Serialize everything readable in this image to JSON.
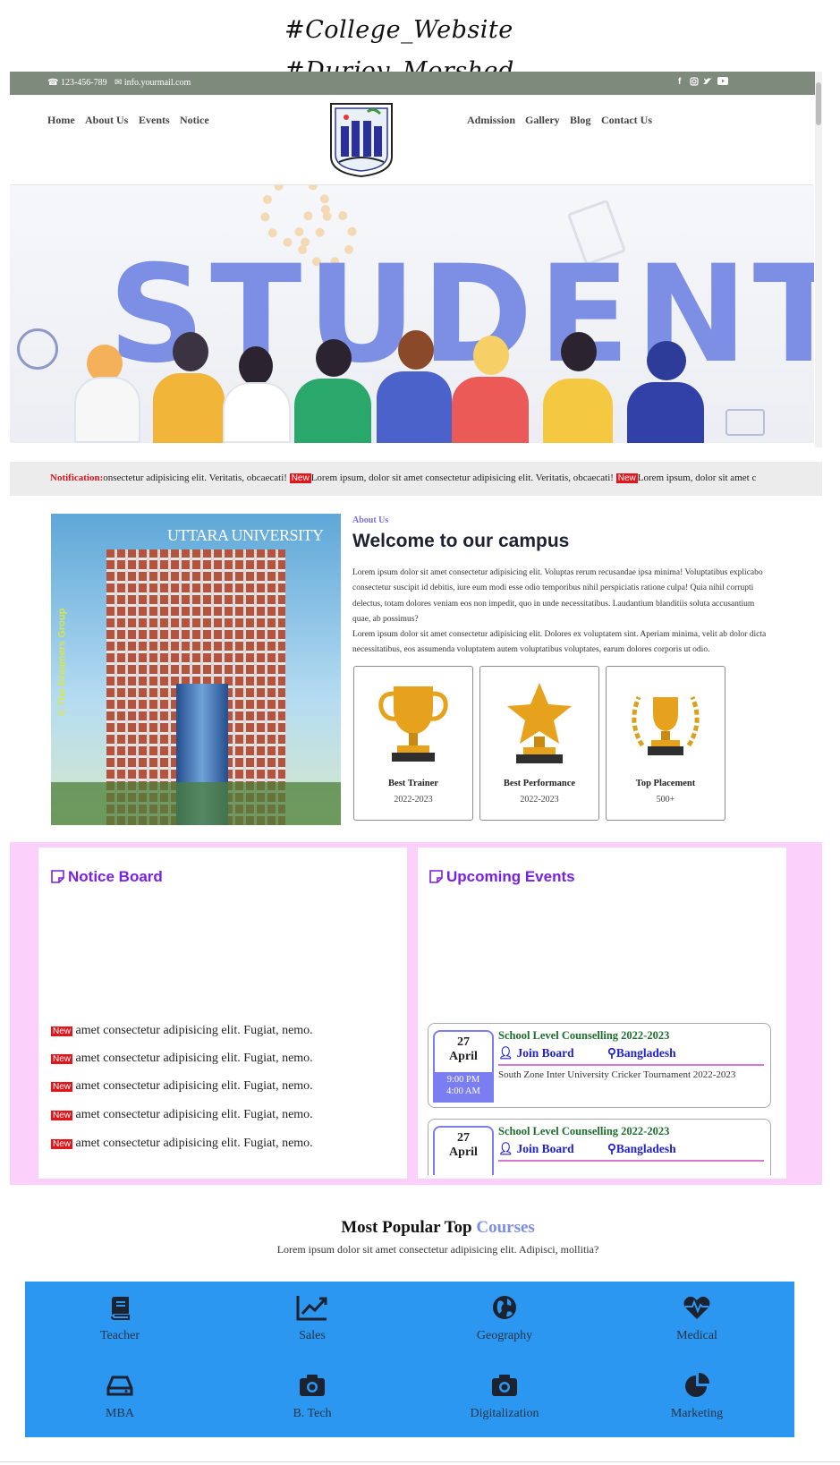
{
  "watermark": {
    "line1": "#College_Website",
    "line2": "#Durjoy_Morshed"
  },
  "topbar": {
    "phone": "123-456-789",
    "email": "info.yourmail.com",
    "social": [
      "facebook-icon",
      "instagram-icon",
      "twitter-icon",
      "youtube-icon"
    ]
  },
  "nav": {
    "left": [
      "Home",
      "About Us",
      "Events",
      "Notice"
    ],
    "right": [
      "Admission",
      "Gallery",
      "Blog",
      "Contact Us"
    ]
  },
  "hero": {
    "title": "STUDENTS"
  },
  "notification": {
    "label": "Notification:",
    "segments": [
      {
        "text": "onsectetur adipisicing elit. Veritatis, obcaecati!",
        "tag": "New"
      },
      {
        "text": "Lorem ipsum, dolor sit amet consectetur adipisicing elit. Veritatis, obcaecati!",
        "tag": "New"
      },
      {
        "text": "Lorem ipsum, dolor sit amet c",
        "tag": ""
      }
    ]
  },
  "about": {
    "kicker": "About Us",
    "title": "Welcome to our campus",
    "building_sign": "UTTARA UNIVERSITY",
    "building_credit": "© The Dreamers Group",
    "para1": "Lorem ipsum dolor sit amet consectetur adipisicing elit. Voluptas rerum recusandae ipsa minima! Voluptatibus explicabo consectetur suscipit id debitis, iure eum modi esse odio temporibus nihil perspiciatis ratione culpa! Quia nihil corrupti delectus, totam dolores veniam eos non impedit, quo in unde necessitatibus. Laudantium blanditiis soluta accusantium quae, ab possimus?",
    "para2": "Lorem ipsum dolor sit amet consectetur adipisicing elit. Dolores ex voluptatem sint. Aperiam minima, velit ab dolor dicta necessitatibus, eos assumenda voluptatem autem voluptatibus voluptates, earum dolores corporis ut odio.",
    "cards": [
      {
        "icon": "trophy-cup-icon",
        "title": "Best Trainer",
        "sub": "2022-2023"
      },
      {
        "icon": "star-trophy-icon",
        "title": "Best Performance",
        "sub": "2022-2023"
      },
      {
        "icon": "laurel-trophy-icon",
        "title": "Top Placement",
        "sub": "500+"
      }
    ]
  },
  "notice_board": {
    "title": "Notice Board",
    "tag": "New",
    "items": [
      "amet consectetur adipisicing elit. Fugiat, nemo.",
      "amet consectetur adipisicing elit. Fugiat, nemo.",
      "amet consectetur adipisicing elit. Fugiat, nemo.",
      "amet consectetur adipisicing elit. Fugiat, nemo.",
      "amet consectetur adipisicing elit. Fugiat, nemo."
    ]
  },
  "events": {
    "title": "Upcoming Events",
    "items": [
      {
        "day": "27",
        "month": "April",
        "time1": "9:00 PM",
        "time2": "4:00 AM",
        "title": "School Level Counselling 2022-2023",
        "org": "Join Board",
        "place": "Bangladesh",
        "desc": "South Zone Inter University Cricker Tournament 2022-2023"
      },
      {
        "day": "27",
        "month": "April",
        "time1": "",
        "time2": "",
        "title": "School Level Counselling 2022-2023",
        "org": "Join Board",
        "place": "Bangladesh",
        "desc": ""
      }
    ]
  },
  "courses": {
    "title_main": "Most Popular Top ",
    "title_accent": "Courses",
    "subtitle": "Lorem ipsum dolor sit amet consectetur adipisicing elit. Adipisci, mollitia?",
    "items": [
      {
        "label": "Teacher",
        "icon": "book-icon"
      },
      {
        "label": "Sales",
        "icon": "chart-line-icon"
      },
      {
        "label": "Geography",
        "icon": "globe-icon"
      },
      {
        "label": "Medical",
        "icon": "heartbeat-icon"
      },
      {
        "label": "MBA",
        "icon": "hdd-icon"
      },
      {
        "label": "B. Tech",
        "icon": "camera-icon"
      },
      {
        "label": "Digitalization",
        "icon": "camera-icon"
      },
      {
        "label": "Marketing",
        "icon": "pie-chart-icon"
      }
    ]
  },
  "colors": {
    "topbar": "#7e8a7c",
    "accent": "#7a1fe6",
    "hero_text": "#7d8fe4",
    "pink": "#fbd0fb",
    "courses_bg": "#2b97f0",
    "new_tag": "#e1161c"
  }
}
